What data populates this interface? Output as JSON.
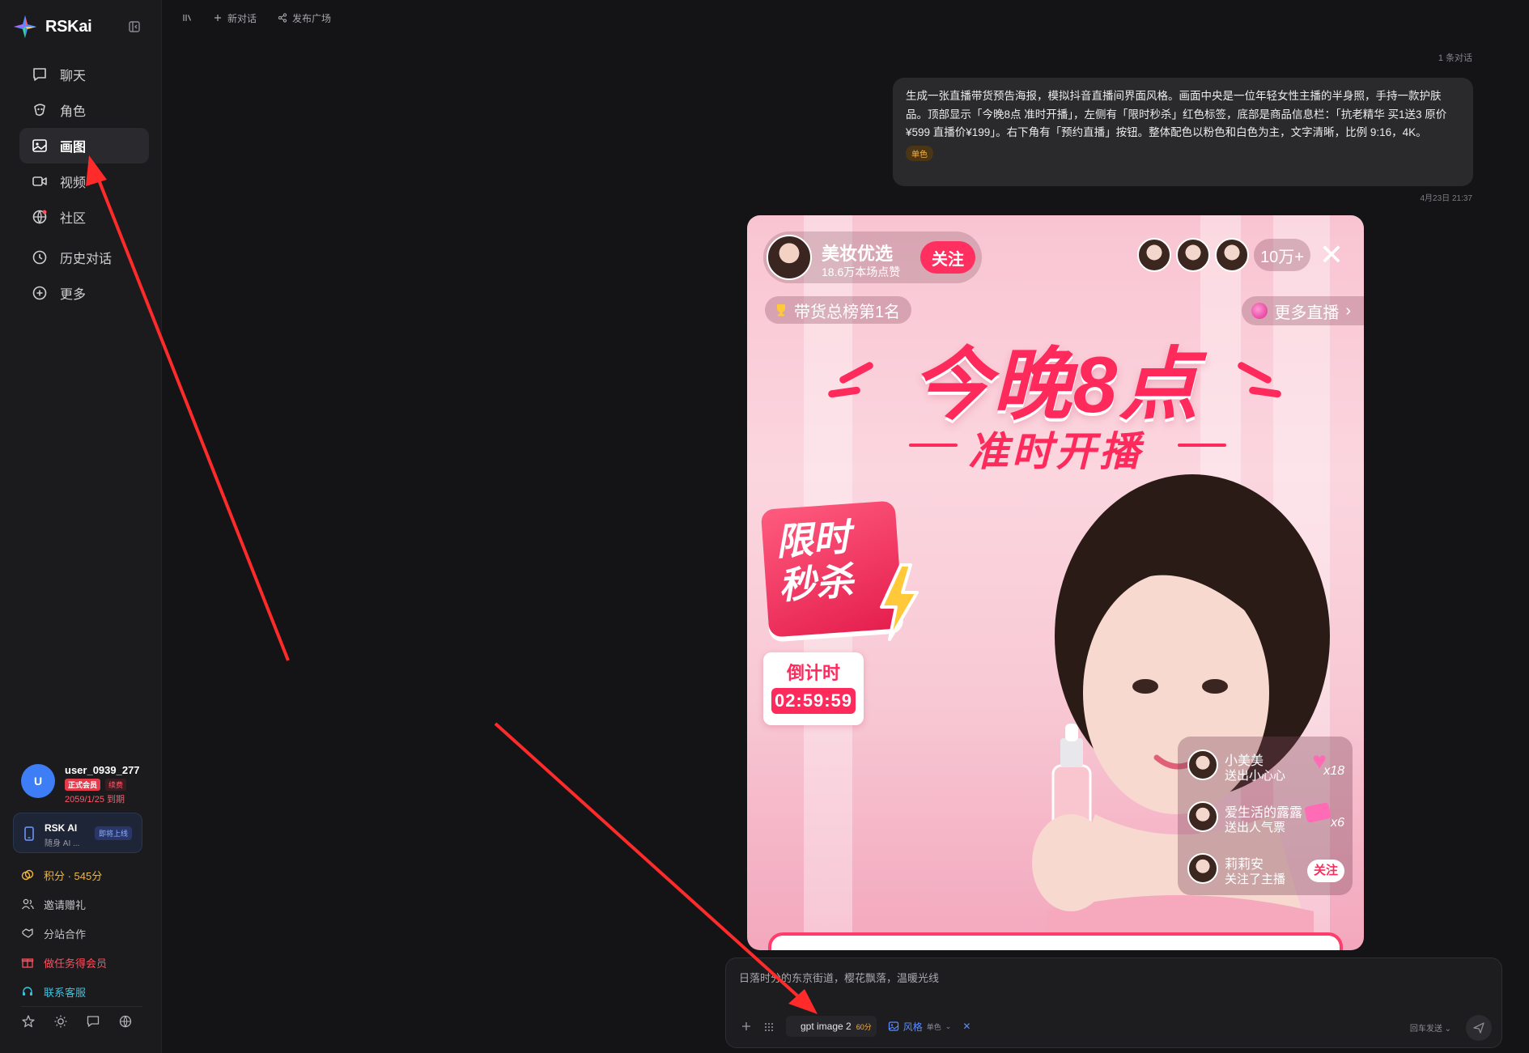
{
  "brand": {
    "name": "RSKai"
  },
  "nav": [
    {
      "label": "聊天",
      "icon": "chat-icon"
    },
    {
      "label": "角色",
      "icon": "mask-icon"
    },
    {
      "label": "画图",
      "icon": "image-icon",
      "active": true
    },
    {
      "label": "视频",
      "icon": "video-icon"
    },
    {
      "label": "社区",
      "icon": "community-icon"
    },
    {
      "label": "历史对话",
      "icon": "clock-icon"
    },
    {
      "label": "更多",
      "icon": "plus-circle-icon"
    }
  ],
  "account": {
    "avatar_letter": "U",
    "username": "user_0939_277",
    "vip_badge": "正式会员",
    "renew_badge": "续费",
    "expire": "2059/1/25 到期"
  },
  "app_card": {
    "title": "RSK AI",
    "subtitle": "随身 AI ...",
    "badge": "即将上线"
  },
  "links": [
    {
      "label": "积分 · 545分",
      "icon": "coin-icon"
    },
    {
      "label": "邀请赠礼",
      "icon": "users-icon"
    },
    {
      "label": "分站合作",
      "icon": "handshake-icon"
    },
    {
      "label": "做任务得会员",
      "icon": "gift-icon"
    },
    {
      "label": "联系客服",
      "icon": "headset-icon"
    }
  ],
  "topbar": {
    "library_icon": "library-icon",
    "new_chat": "新对话",
    "publish": "发布广场"
  },
  "conversation_count": "1 条对话",
  "message": {
    "text": "生成一张直播带货预告海报，模拟抖音直播间界面风格。画面中央是一位年轻女性主播的半身照，手持一款护肤品。顶部显示「今晚8点 准时开播」，左侧有「限时秒杀」红色标签，底部是商品信息栏：「抗老精华 买1送3 原价¥599 直播价¥199」。右下角有「预约直播」按钮。整体配色以粉色和白色为主，文字清晰，比例 9:16，4K。",
    "tag": "单色",
    "time": "4月23日 21:37"
  },
  "poster": {
    "host_name": "美妆优选",
    "host_likes": "18.6万本场点赞",
    "follow": "关注",
    "viewer_count": "10万+",
    "close": "✕",
    "rank": "带货总榜第1名",
    "more_live": "更多直播",
    "headline": "今晚8点",
    "subline": "准时开播",
    "flash_line1": "限时",
    "flash_line2": "秒杀",
    "countdown_label": "倒计时",
    "countdown_time": "02:59:59",
    "gifts": [
      {
        "name": "小美美",
        "msg": "送出小心心",
        "num": "x18"
      },
      {
        "name": "爱生活的露露",
        "msg": "送出人气票",
        "num": "x6"
      },
      {
        "name": "莉莉安",
        "msg": "关注了主播",
        "action": "关注"
      }
    ],
    "colors": {
      "accent": "#ff2a5c",
      "background": "#f9c4d2"
    }
  },
  "composer": {
    "text": "日落时分的东京街道，樱花飘落，温暖光线",
    "model": "gpt image 2",
    "model_cost": "60分",
    "style": "风格",
    "style_value": "单色",
    "clear": "✕",
    "send_mode": "回车发送"
  }
}
